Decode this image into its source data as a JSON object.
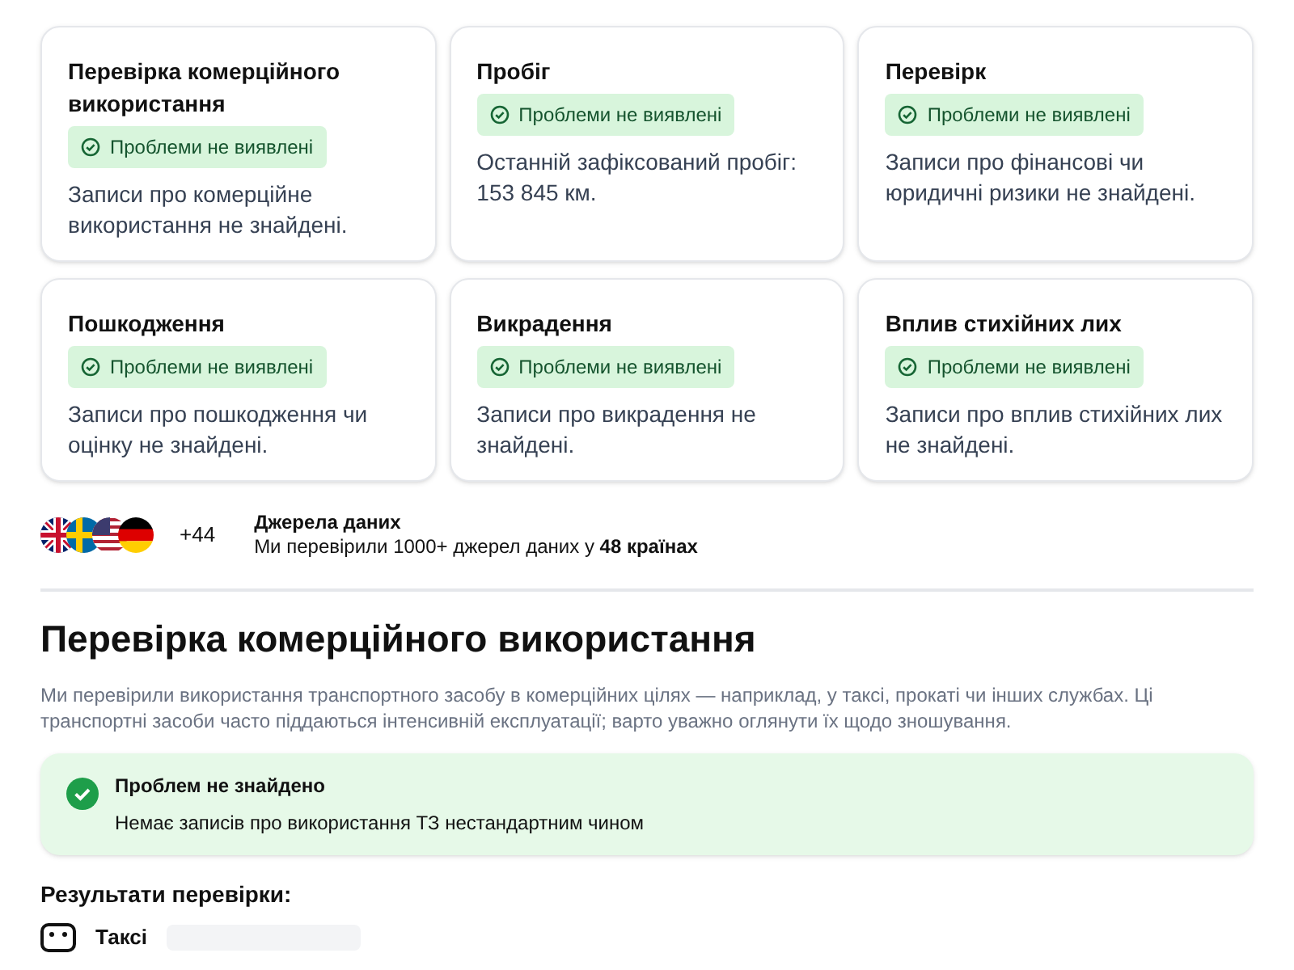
{
  "checks": [
    {
      "title": "Перевірка комерційного використання",
      "badge": "Проблеми не виявлені",
      "ok": true,
      "text": "Записи про комерційне використання не знайдені."
    },
    {
      "title": "Пробіг",
      "badge": "Проблеми не виявлені",
      "ok": true,
      "text": "Останній зафіксований пробіг: 153 845 км."
    },
    {
      "title": "Перевірк",
      "badge": "Проблеми не виявлені",
      "ok": true,
      "text": "Записи про фінансові чи юридичні ризики не знайдені."
    },
    {
      "title": "Пошкодження",
      "badge": "Проблеми не виявлені",
      "ok": true,
      "text": "Записи про пошкодження чи оцінку не знайдені."
    },
    {
      "title": "Викрадення",
      "badge": "Проблеми не виявлені",
      "ok": true,
      "text": "Записи про викрадення не знайдені."
    },
    {
      "title": "Вплив стихійних лих",
      "badge": "Проблеми не виявлені",
      "ok": true,
      "text": "Записи про вплив стихійних лих не знайдені."
    }
  ],
  "sources": {
    "more_count": "+44",
    "title": "Джерела даних",
    "text": "Ми перевірили 1000+ джерел даних у **48 країнах**"
  },
  "section": {
    "title": "Перевірка комерційного використання",
    "description": "Ми перевірили використання транспортного засобу в комерційних цілях — наприклад, у таксі, прокаті чи інших службах. Ці транспортні засоби часто піддаються інтенсивній експлуатації; варто уважно оглянути їх щодо зношування.",
    "alert": {
      "ok": true,
      "title": "Проблем не знайдено",
      "text": "Немає записів про використання ТЗ нестандартним чином"
    },
    "results_title": "Результати перевірки:",
    "results": [
      {
        "label": "Таксі"
      }
    ]
  }
}
